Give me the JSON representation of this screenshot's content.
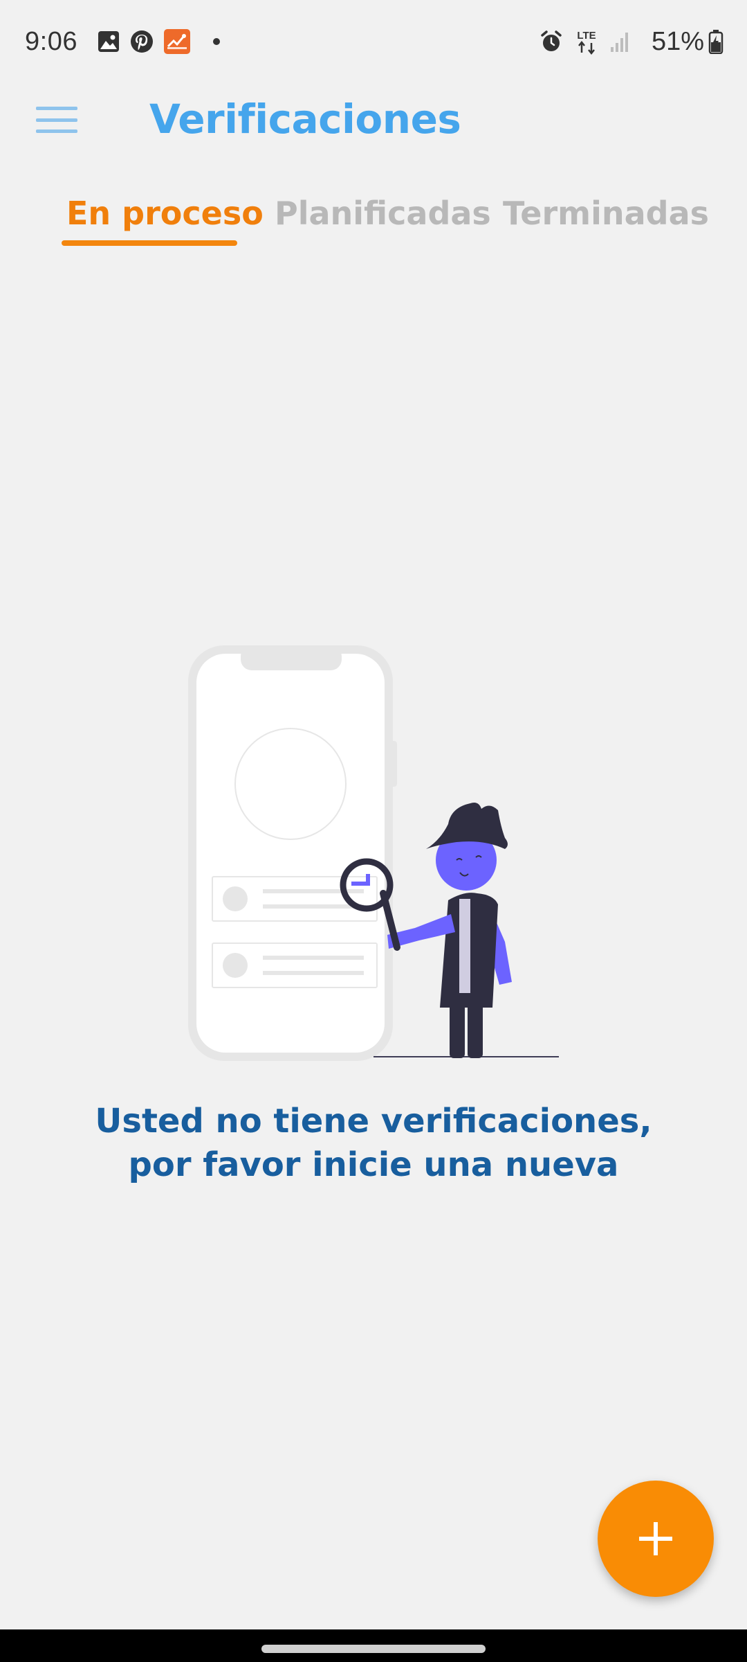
{
  "status_bar": {
    "time": "9:06",
    "left_icons": [
      "gallery-icon",
      "pinterest-icon",
      "app-notification-icon",
      "notification-dot-icon"
    ],
    "right_icons": [
      "alarm-icon",
      "lte-data-icon",
      "signal-icon",
      "battery-icon"
    ],
    "network": "LTE",
    "battery": "51%"
  },
  "app_bar": {
    "title": "Verificaciones",
    "menu_icon": "hamburger-menu-icon"
  },
  "tabs": [
    {
      "label": "En proceso",
      "active": true
    },
    {
      "label": "Planificadas",
      "active": false
    },
    {
      "label": "Terminadas",
      "active": false
    }
  ],
  "empty_state": {
    "illustration": "detective-searching-phone-illustration",
    "message": "Usted no tiene verificaciones, por favor inicie una nueva"
  },
  "fab": {
    "icon": "plus-icon"
  },
  "colors": {
    "background": "#f1f1f1",
    "title": "#45a5ec",
    "accent": "#f07f0c",
    "tab_inactive": "#b8b8b8",
    "message": "#185e9e",
    "fab": "#f98c05"
  }
}
